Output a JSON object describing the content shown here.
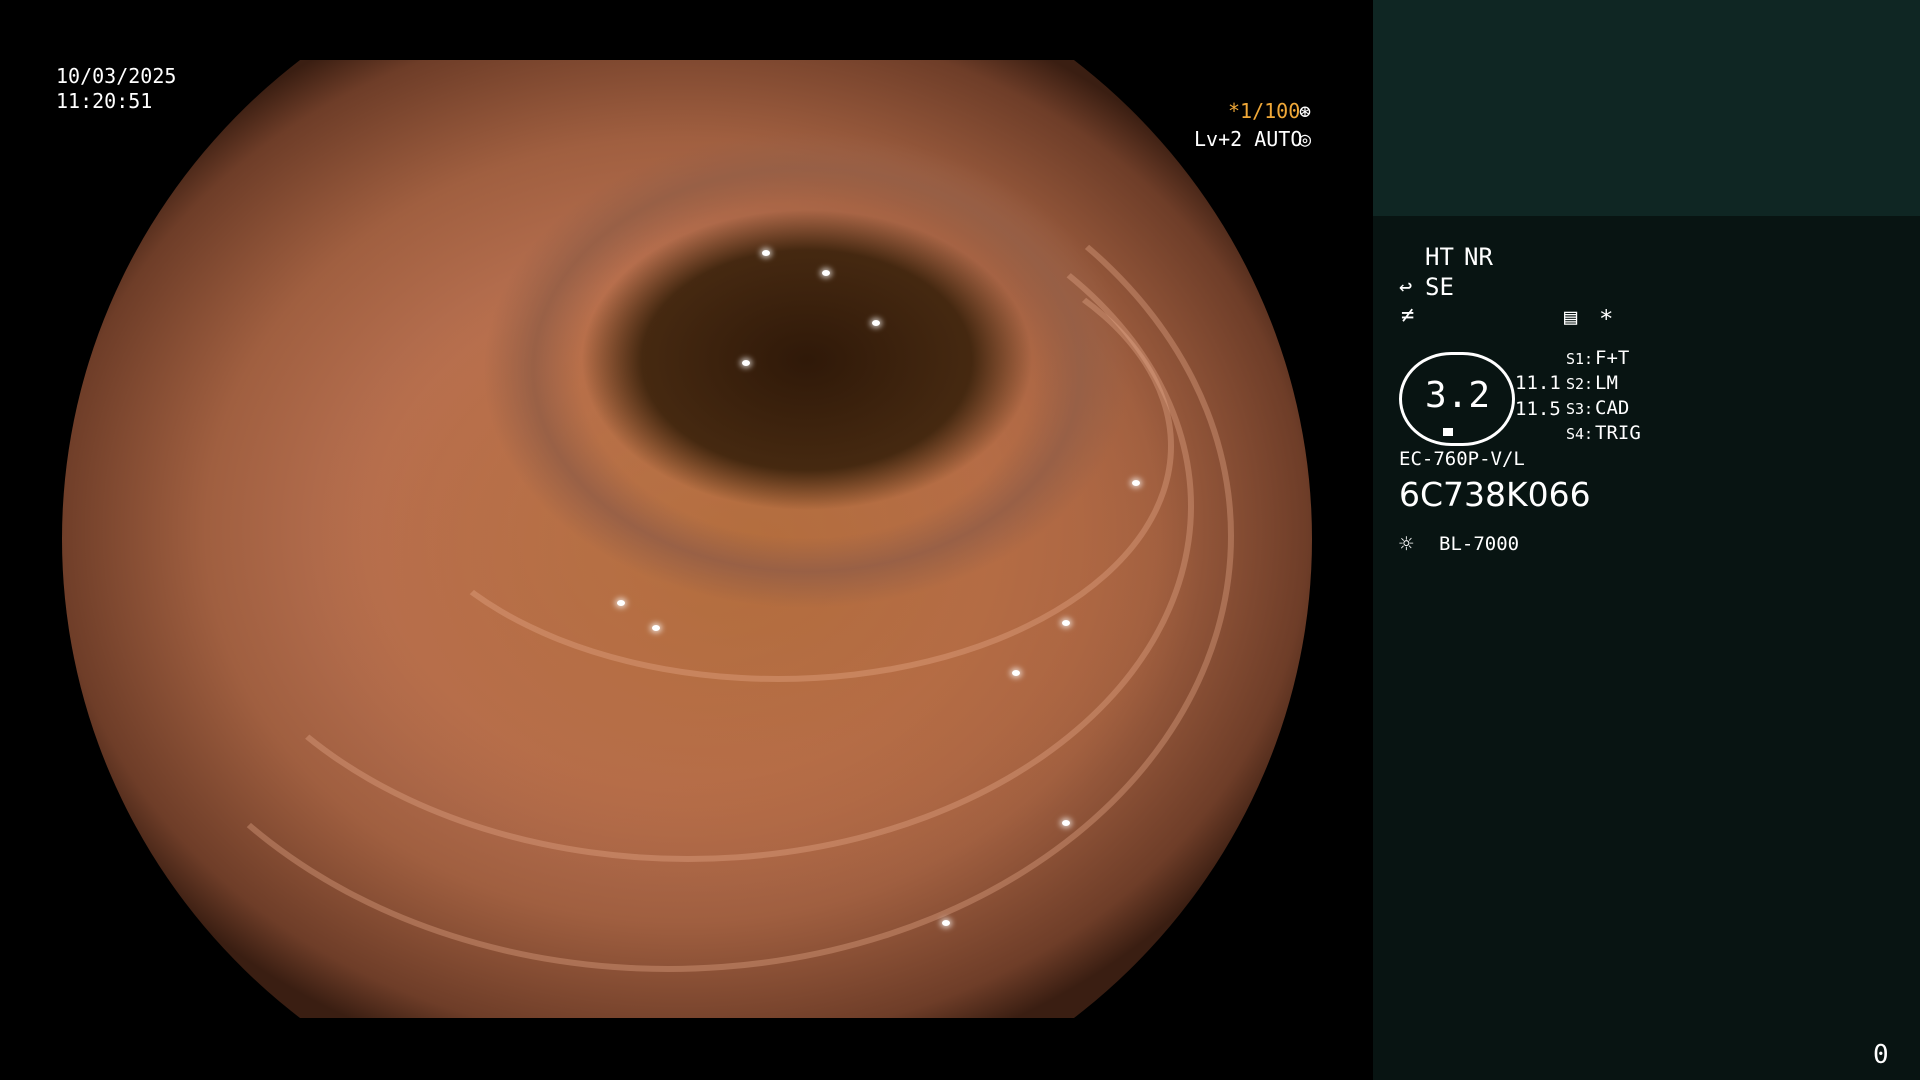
{
  "video": {
    "date": "10/03/2025",
    "time": "11:20:51",
    "shutter": "*1/100",
    "shutter_icon": "aperture-icon",
    "level": "Lv+2 AUTO",
    "level_icon": "iris-icon"
  },
  "panel": {
    "ht_label": "HT",
    "nr_label": "NR",
    "se_label": "SE",
    "se_icon": "scope-bend-icon",
    "freeze_icon": "not-equal-icon",
    "memo_icon": "memo-icon",
    "star": "*",
    "zoom_value": "3.2",
    "readings": [
      "11.1",
      "11.5"
    ],
    "switches": [
      {
        "key": "S1:",
        "value": "F+T"
      },
      {
        "key": "S2:",
        "value": "LM"
      },
      {
        "key": "S3:",
        "value": "CAD"
      },
      {
        "key": "S4:",
        "value": "TRIG"
      }
    ],
    "scope_model": "EC-760P-V/L",
    "serial": "6C738K066",
    "light_icon": "lamp-icon",
    "light_source": "BL-7000",
    "counter": "0"
  },
  "colors": {
    "panel_bg": "#081412",
    "panel_top_bg": "#0f2623",
    "accent": "#f0a838"
  }
}
